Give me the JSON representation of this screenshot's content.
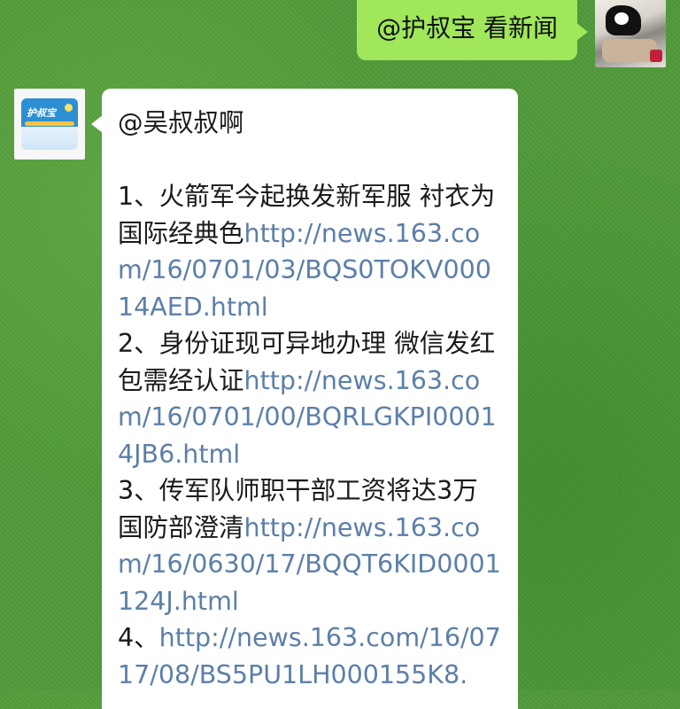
{
  "outgoing": {
    "text": "@护叔宝 看新闻"
  },
  "incoming": {
    "mention": "@吴叔叔啊",
    "items": [
      {
        "prefix": "1、火箭军今起换发新军服 衬衣为国际经典色",
        "link": "http://news.163.com/16/0701/03/BQS0TOKV00014AED.html"
      },
      {
        "prefix": "2、身份证现可异地办理 微信发红包需经认证",
        "link": "http://news.163.com/16/0701/00/BQRLGKPI00014JB6.html"
      },
      {
        "prefix": "3、传军队师职干部工资将达3万 国防部澄清",
        "link": "http://news.163.com/16/0630/17/BQQT6KID0001124J.html"
      },
      {
        "prefix": "4、",
        "link": "http://news.163.com/16/0717/08/BS5PU1LH000155K8."
      }
    ]
  },
  "avatars": {
    "me": "user-photo-avatar",
    "bot": "diaper-pack-avatar"
  },
  "colors": {
    "outgoing_bubble": "#a0e75a",
    "incoming_bubble": "#ffffff",
    "link": "#5c7fa8",
    "background": "#4f9a3a"
  }
}
